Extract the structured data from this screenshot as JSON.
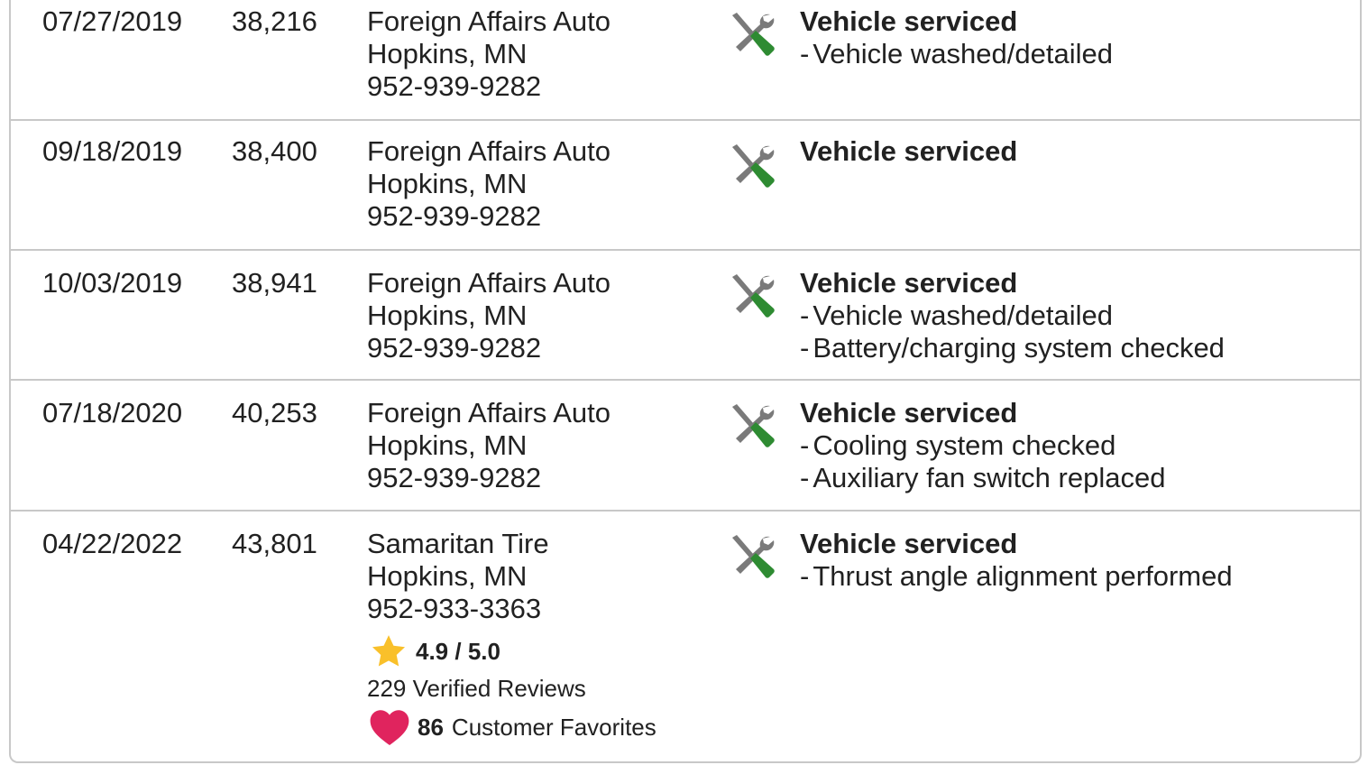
{
  "colors": {
    "border": "#c8c8c8",
    "wrench_gray": "#7a7a7a",
    "wrench_green": "#2e8b32",
    "star": "#f9c02a",
    "heart": "#e0245e"
  },
  "icon_name": "service-tools-icon",
  "records": [
    {
      "date": "07/27/2019",
      "mileage": "38,216",
      "shop": {
        "name": "Foreign Affairs Auto",
        "location": "Hopkins, MN",
        "phone": "952-939-9282"
      },
      "title": "Vehicle serviced",
      "items": [
        "Vehicle washed/detailed"
      ]
    },
    {
      "date": "09/18/2019",
      "mileage": "38,400",
      "shop": {
        "name": "Foreign Affairs Auto",
        "location": "Hopkins, MN",
        "phone": "952-939-9282"
      },
      "title": "Vehicle serviced",
      "items": []
    },
    {
      "date": "10/03/2019",
      "mileage": "38,941",
      "shop": {
        "name": "Foreign Affairs Auto",
        "location": "Hopkins, MN",
        "phone": "952-939-9282"
      },
      "title": "Vehicle serviced",
      "items": [
        "Vehicle washed/detailed",
        "Battery/charging system checked"
      ]
    },
    {
      "date": "07/18/2020",
      "mileage": "40,253",
      "shop": {
        "name": "Foreign Affairs Auto",
        "location": "Hopkins, MN",
        "phone": "952-939-9282"
      },
      "title": "Vehicle serviced",
      "items": [
        "Cooling system checked",
        "Auxiliary fan switch replaced"
      ]
    },
    {
      "date": "04/22/2022",
      "mileage": "43,801",
      "shop": {
        "name": "Samaritan Tire",
        "location": "Hopkins, MN",
        "phone": "952-933-3363"
      },
      "title": "Vehicle serviced",
      "items": [
        "Thrust angle alignment performed"
      ],
      "rating": {
        "value": "4.9 / 5.0",
        "reviews": "229 Verified Reviews",
        "favorites_count": "86",
        "favorites_label": "Customer Favorites"
      }
    }
  ]
}
